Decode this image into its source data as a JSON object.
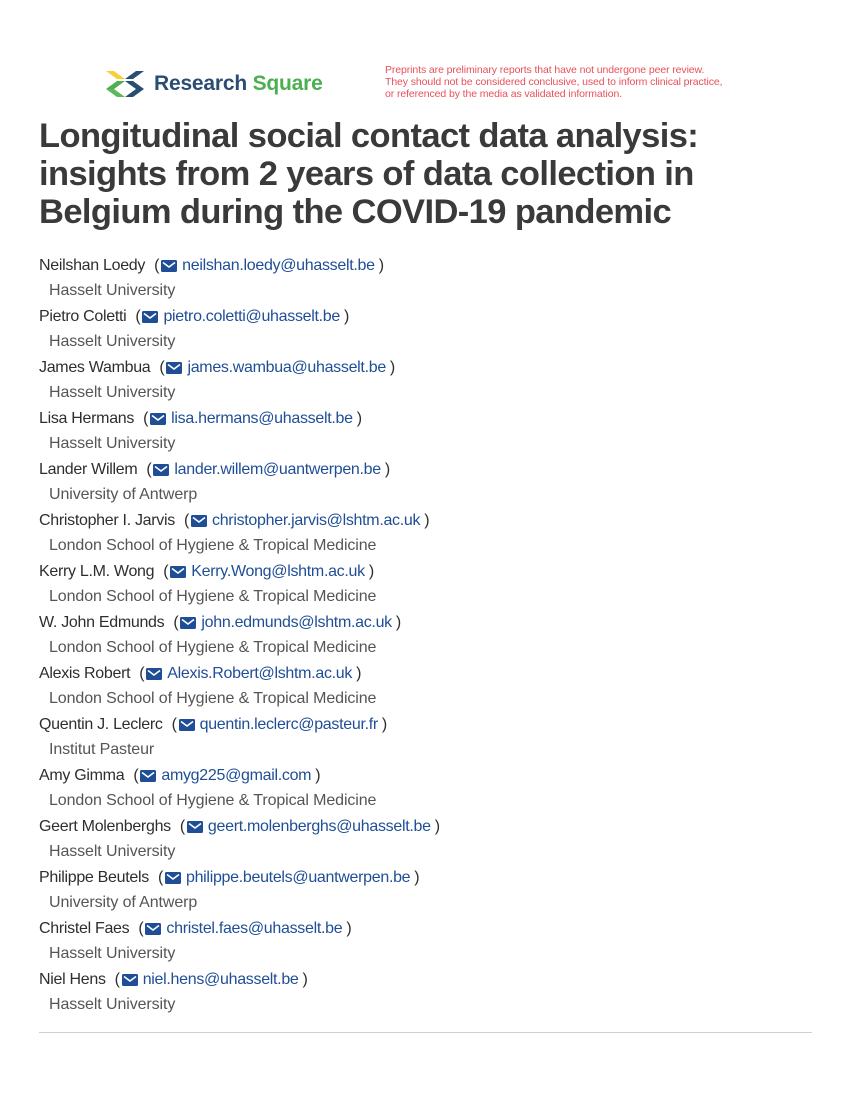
{
  "header": {
    "brand": {
      "word1": "Research",
      "word2": "Square",
      "logo_icon": "research-square-logo"
    },
    "disclaimer_lines": [
      "Preprints are preliminary reports that have not undergone peer review.",
      "They should not be considered conclusive, used to inform clinical practice,",
      "or referenced by the media as validated information."
    ],
    "colors": {
      "brand_dark": "#2a4d73",
      "brand_green": "#4caf50",
      "disclaimer": "#e8505b",
      "email_link": "#1f4e96"
    }
  },
  "paper": {
    "title": "Longitudinal social contact data analysis: insights from 2 years of data collection in Belgium during the COVID-19 pandemic"
  },
  "authors": [
    {
      "name": "Neilshan Loedy",
      "email": "neilshan.loedy@uhasselt.be",
      "affiliation": "Hasselt University"
    },
    {
      "name": "Pietro Coletti",
      "email": "pietro.coletti@uhasselt.be",
      "affiliation": "Hasselt University"
    },
    {
      "name": "James Wambua",
      "email": "james.wambua@uhasselt.be",
      "affiliation": "Hasselt University"
    },
    {
      "name": "Lisa Hermans",
      "email": "lisa.hermans@uhasselt.be",
      "affiliation": "Hasselt University"
    },
    {
      "name": "Lander Willem",
      "email": "lander.willem@uantwerpen.be",
      "affiliation": "University of Antwerp"
    },
    {
      "name": "Christopher I. Jarvis",
      "email": "christopher.jarvis@lshtm.ac.uk",
      "affiliation": "London School of Hygiene & Tropical Medicine"
    },
    {
      "name": "Kerry L.M. Wong",
      "email": "Kerry.Wong@lshtm.ac.uk",
      "affiliation": "London School of Hygiene & Tropical Medicine"
    },
    {
      "name": "W. John Edmunds",
      "email": "john.edmunds@lshtm.ac.uk",
      "affiliation": "London School of Hygiene & Tropical Medicine"
    },
    {
      "name": "Alexis Robert",
      "email": "Alexis.Robert@lshtm.ac.uk",
      "affiliation": "London School of Hygiene & Tropical Medicine"
    },
    {
      "name": "Quentin J. Leclerc",
      "email": "quentin.leclerc@pasteur.fr",
      "affiliation": "Institut Pasteur"
    },
    {
      "name": "Amy Gimma",
      "email": "amyg225@gmail.com",
      "affiliation": "London School of Hygiene & Tropical Medicine"
    },
    {
      "name": "Geert Molenberghs",
      "email": "geert.molenberghs@uhasselt.be",
      "affiliation": "Hasselt University"
    },
    {
      "name": "Philippe Beutels",
      "email": "philippe.beutels@uantwerpen.be",
      "affiliation": "University of Antwerp"
    },
    {
      "name": "Christel Faes",
      "email": "christel.faes@uhasselt.be",
      "affiliation": "Hasselt University"
    },
    {
      "name": "Niel Hens",
      "email": "niel.hens@uhasselt.be",
      "affiliation": "Hasselt University"
    }
  ],
  "punctuation": {
    "open_paren": "(",
    "close_paren": ")"
  },
  "icons": {
    "email": "envelope-icon"
  }
}
